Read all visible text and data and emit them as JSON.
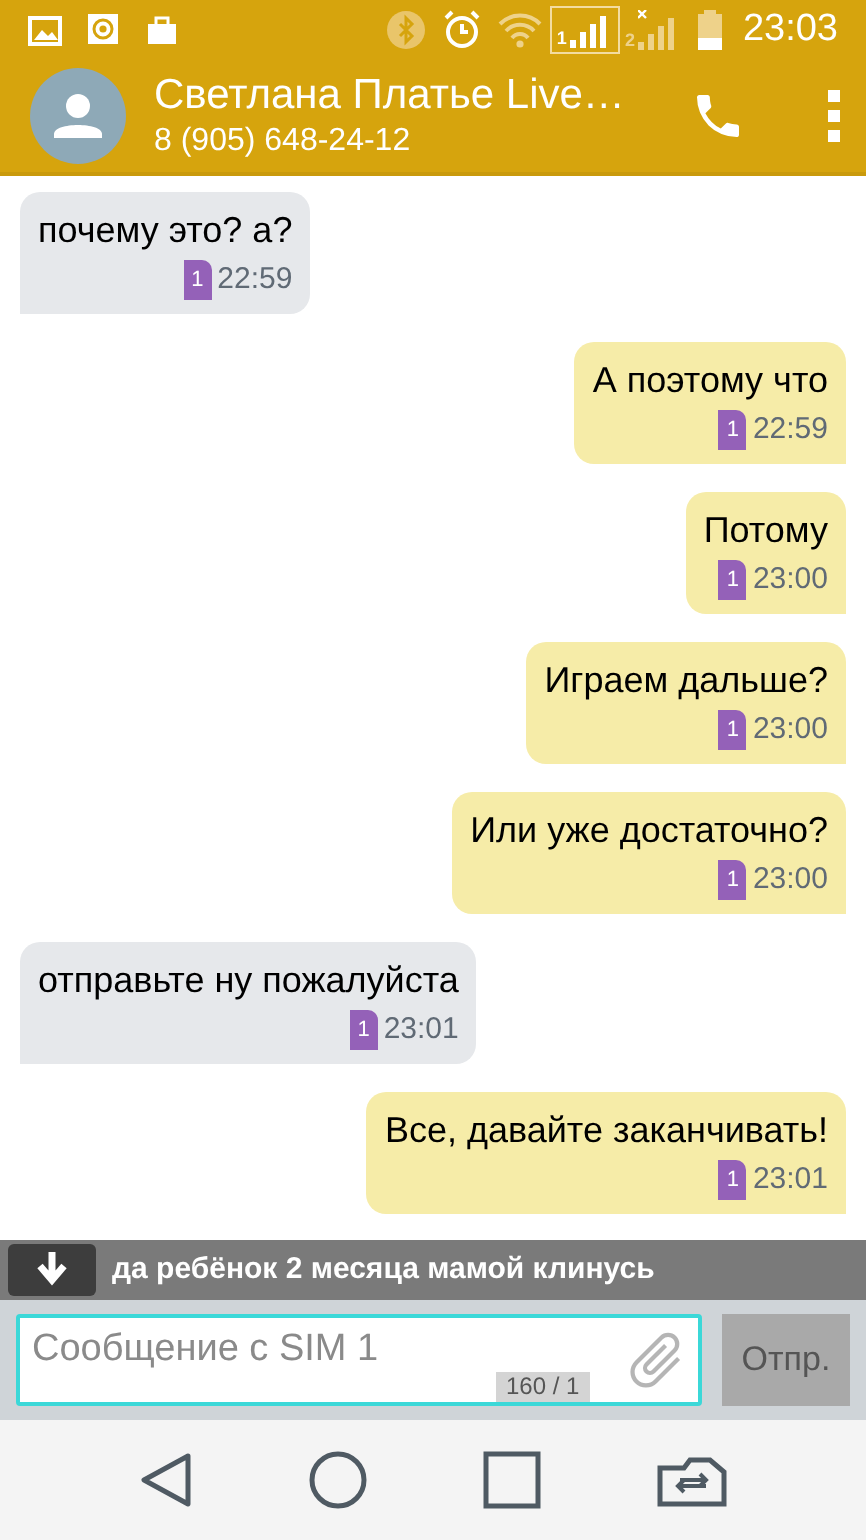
{
  "status_bar": {
    "sim_1": "1",
    "sim_2": "2",
    "time": "23:03"
  },
  "header": {
    "name": "Светлана Платье Live…",
    "phone": "8 (905) 648-24-12"
  },
  "messages": [
    {
      "kind": "incoming",
      "text": "почему это? а?",
      "sim": "1",
      "time": "22:59"
    },
    {
      "kind": "outgoing",
      "text": "А поэтому что",
      "sim": "1",
      "time": "22:59"
    },
    {
      "kind": "outgoing",
      "text": "Потому",
      "sim": "1",
      "time": "23:00"
    },
    {
      "kind": "outgoing",
      "text": "Играем дальше?",
      "sim": "1",
      "time": "23:00"
    },
    {
      "kind": "outgoing",
      "text": "Или уже достаточно?",
      "sim": "1",
      "time": "23:00"
    },
    {
      "kind": "incoming",
      "text": "отправьте ну пожалуйста",
      "sim": "1",
      "time": "23:01"
    },
    {
      "kind": "outgoing",
      "text": "Все, давайте заканчивать!",
      "sim": "1",
      "time": "23:01"
    }
  ],
  "notification": {
    "text": "да ребёнок 2 месяца мамой клинусь"
  },
  "composer": {
    "placeholder": "Сообщение с SIM 1",
    "counter": "160 / 1",
    "send": "Отпр."
  }
}
